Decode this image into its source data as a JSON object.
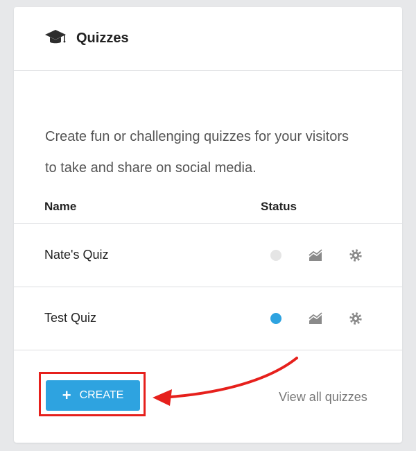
{
  "card": {
    "title": "Quizzes",
    "description": "Create fun or challenging quizzes for your visitors to take and share on social media.",
    "header_icon": "graduation-cap-icon"
  },
  "table": {
    "headers": {
      "name": "Name",
      "status": "Status"
    },
    "rows": [
      {
        "name": "Nate's Quiz",
        "status_color": "#e5e5e5",
        "analytics_icon": "analytics-chart-icon",
        "settings_icon": "gear-icon"
      },
      {
        "name": "Test Quiz",
        "status_color": "#2ea3e0",
        "analytics_icon": "analytics-chart-icon",
        "settings_icon": "gear-icon"
      }
    ]
  },
  "footer": {
    "create_label": "CREATE",
    "create_icon": "plus-icon",
    "view_all_label": "View all quizzes"
  },
  "colors": {
    "accent": "#2ea3e0",
    "annotation": "#e6201c",
    "inactive_status": "#e5e5e5"
  }
}
